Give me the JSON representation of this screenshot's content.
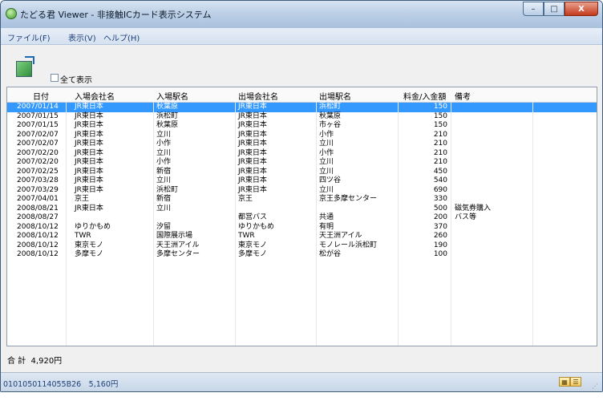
{
  "window": {
    "title": "たどる君 Viewer - 非接触ICカード表示システム",
    "minimize": "–",
    "maximize": "□",
    "close": "X"
  },
  "menu": [
    "ファイル(F)",
    "表示(V)",
    "ヘルプ(H)"
  ],
  "toolbar": {
    "icon": "export-icon",
    "show_all_label": "全て表示",
    "show_all_checked": false
  },
  "table": {
    "columns": [
      "日付",
      "入場会社名",
      "入場駅名",
      "出場会社名",
      "出場駅名",
      "料金/入金額",
      "備考"
    ],
    "rows": [
      [
        "2007/01/14",
        "JR東日本",
        "秋葉原",
        "JR東日本",
        "浜松町",
        "150",
        ""
      ],
      [
        "2007/01/15",
        "JR東日本",
        "浜松町",
        "JR東日本",
        "秋葉原",
        "150",
        ""
      ],
      [
        "2007/01/15",
        "JR東日本",
        "秋葉原",
        "JR東日本",
        "市ヶ谷",
        "150",
        ""
      ],
      [
        "2007/02/07",
        "JR東日本",
        "立川",
        "JR東日本",
        "小作",
        "210",
        ""
      ],
      [
        "2007/02/07",
        "JR東日本",
        "小作",
        "JR東日本",
        "立川",
        "210",
        ""
      ],
      [
        "2007/02/20",
        "JR東日本",
        "立川",
        "JR東日本",
        "小作",
        "210",
        ""
      ],
      [
        "2007/02/20",
        "JR東日本",
        "小作",
        "JR東日本",
        "立川",
        "210",
        ""
      ],
      [
        "2007/02/25",
        "JR東日本",
        "新宿",
        "JR東日本",
        "立川",
        "450",
        ""
      ],
      [
        "2007/03/28",
        "JR東日本",
        "立川",
        "JR東日本",
        "四ツ谷",
        "540",
        ""
      ],
      [
        "2007/03/29",
        "JR東日本",
        "浜松町",
        "JR東日本",
        "立川",
        "690",
        ""
      ],
      [
        "2007/04/01",
        "京王",
        "新宿",
        "京王",
        "京王多摩センター",
        "330",
        ""
      ],
      [
        "2008/08/21",
        "JR東日本",
        "立川",
        "",
        "",
        "500",
        "磁気券購入"
      ],
      [
        "2008/08/27",
        "",
        "",
        "都営バス",
        "共通",
        "200",
        "バス等"
      ],
      [
        "2008/10/12",
        "ゆりかもめ",
        "汐留",
        "ゆりかもめ",
        "有明",
        "370",
        ""
      ],
      [
        "2008/10/12",
        "TWR",
        "国際展示場",
        "TWR",
        "天王洲アイル",
        "260",
        ""
      ],
      [
        "2008/10/12",
        "東京モノ",
        "天王洲アイル",
        "東京モノ",
        "モノレール浜松町",
        "190",
        ""
      ],
      [
        "2008/10/12",
        "多摩モノ",
        "多摩センター",
        "多摩モノ",
        "松が谷",
        "100",
        ""
      ]
    ],
    "selected_row": 0,
    "empty_rows": 6
  },
  "total": {
    "label": "合 計",
    "value": "4,920円"
  },
  "statusbar": {
    "card_info": "0101050114055B26　5,160円",
    "view_icons": [
      "grid-view-icon",
      "list-view-icon"
    ]
  },
  "colors": {
    "selection": "#3399ff",
    "menu_text": "#1f3f79",
    "title_gradient_end": "#a9c1de"
  }
}
